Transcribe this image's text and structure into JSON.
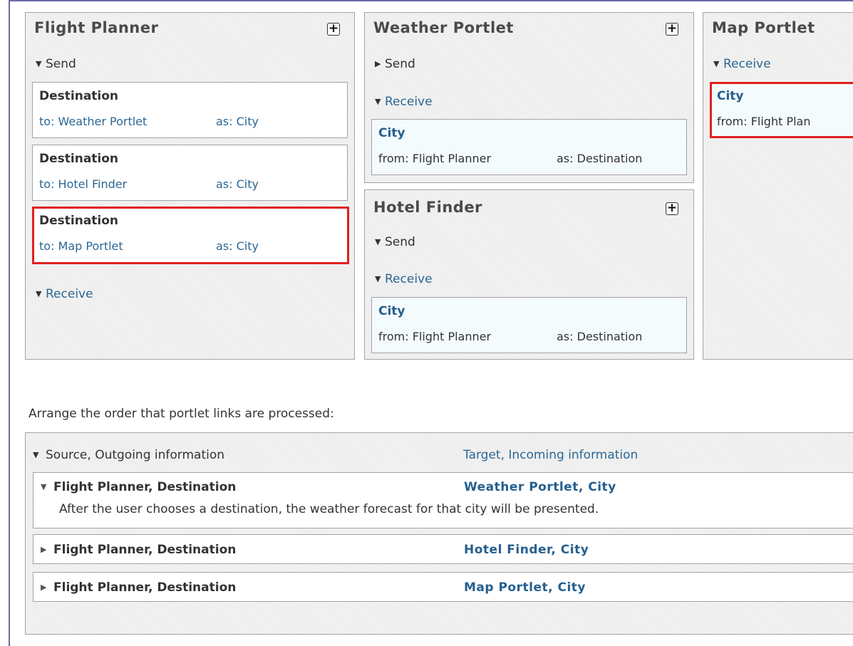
{
  "portlets": {
    "flight_planner": {
      "title": "Flight Planner",
      "send_label": "Send",
      "receive_label": "Receive",
      "send_links": [
        {
          "title": "Destination",
          "to": "to: Weather Portlet",
          "as": "as: City"
        },
        {
          "title": "Destination",
          "to": "to: Hotel Finder",
          "as": "as: City"
        },
        {
          "title": "Destination",
          "to": "to: Map Portlet",
          "as": "as: City"
        }
      ]
    },
    "weather": {
      "title": "Weather Portlet",
      "send_label": "Send",
      "receive_label": "Receive",
      "receive_link": {
        "title": "City",
        "from": "from: Flight Planner",
        "as": "as: Destination"
      }
    },
    "hotel": {
      "title": "Hotel Finder",
      "send_label": "Send",
      "receive_label": "Receive",
      "receive_link": {
        "title": "City",
        "from": "from: Flight Planner",
        "as": "as: Destination"
      }
    },
    "map": {
      "title": "Map Portlet",
      "receive_label": "Receive",
      "receive_link": {
        "title": "City",
        "from": "from: Flight Plan"
      }
    }
  },
  "arrange": {
    "label": "Arrange the order that portlet links are processed:",
    "source_header": "Source, Outgoing information",
    "target_header": "Target, Incoming information",
    "rows": [
      {
        "source": "Flight Planner, Destination",
        "target": "Weather Portlet, City",
        "expanded": true,
        "description": "After the user chooses a destination, the weather forecast for that city will be presented."
      },
      {
        "source": "Flight Planner, Destination",
        "target": "Hotel Finder, City",
        "expanded": false
      },
      {
        "source": "Flight Planner, Destination",
        "target": "Map Portlet, City",
        "expanded": false
      }
    ]
  },
  "icons": {
    "plus": "plus-icon",
    "expanded": "triangle-down-icon",
    "collapsed": "triangle-right-icon"
  },
  "colors": {
    "selected_border": "#e02020",
    "link_blue": "#2b6794",
    "panel_bg": "#ececec"
  }
}
